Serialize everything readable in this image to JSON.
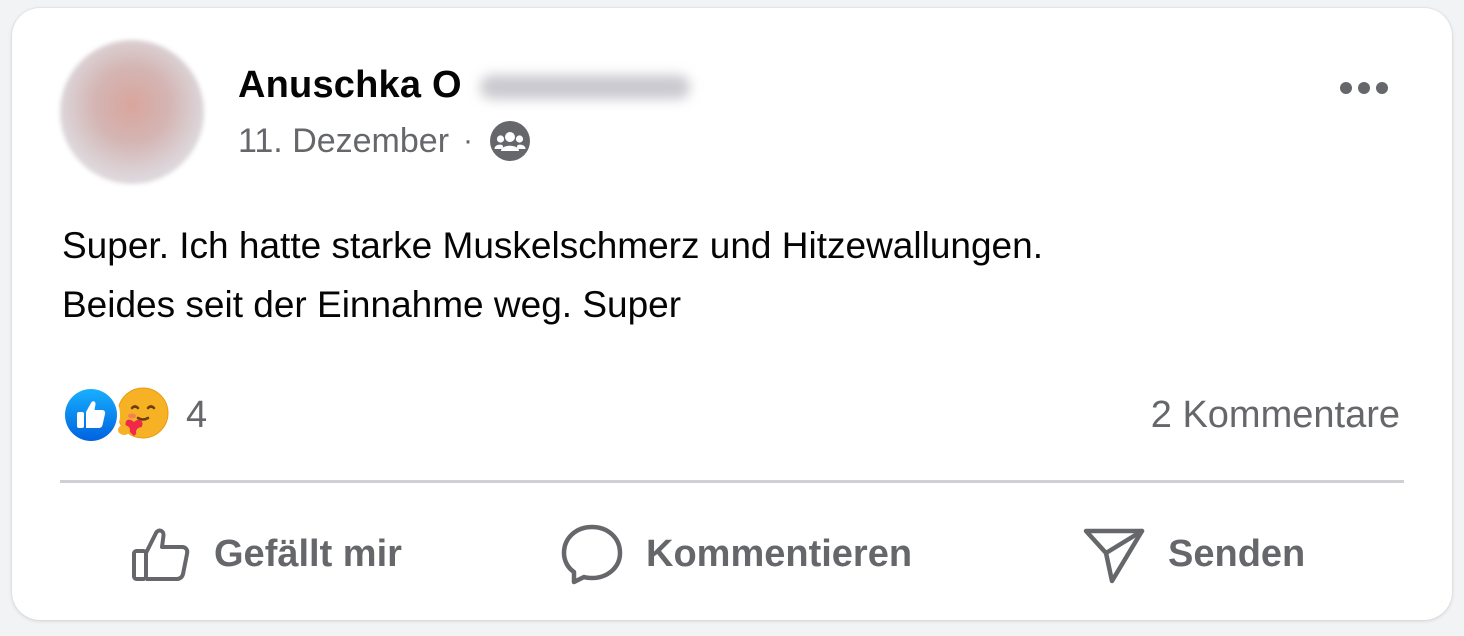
{
  "post": {
    "author_name": "Anuschka O",
    "date": "11. Dezember",
    "separator": "·",
    "audience_icon": "group-icon",
    "more_icon": "more-dots-icon",
    "text_line_1": "Super. Ich hatte starke Muskelschmerz und Hitzewallungen.",
    "text_line_2": "Beides seit der Einnahme weg. Super"
  },
  "reactions": {
    "types": [
      "like-reaction-icon",
      "care-reaction-icon"
    ],
    "count": "4",
    "comments_label": "2 Kommentare"
  },
  "actions": {
    "like_label": "Gefällt mir",
    "comment_label": "Kommentieren",
    "send_label": "Senden"
  },
  "colors": {
    "text_primary": "#050505",
    "text_secondary": "#65676b",
    "like_blue": "#1877f2",
    "divider": "#ced0d4"
  }
}
